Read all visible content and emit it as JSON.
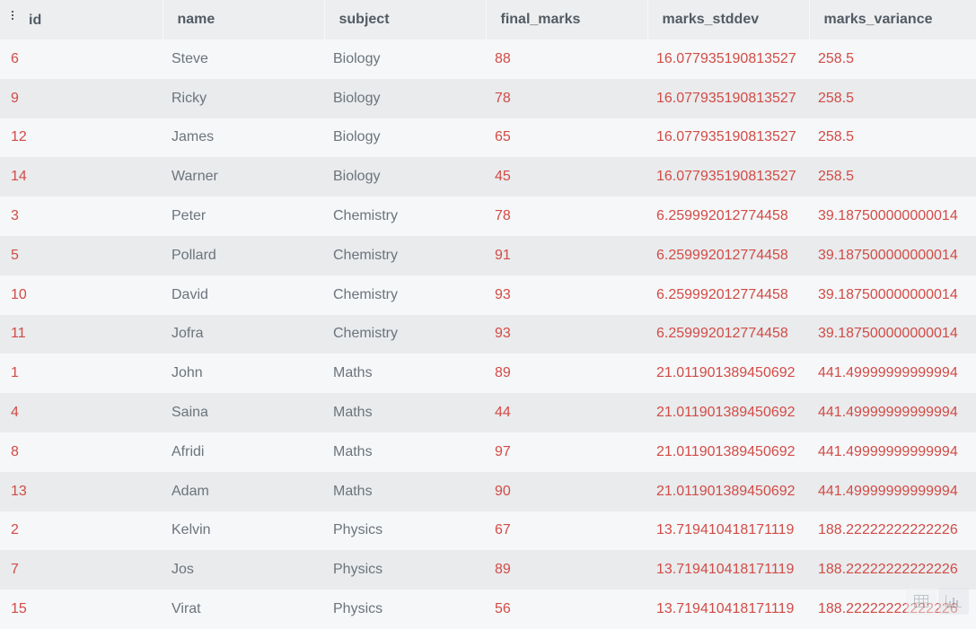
{
  "table": {
    "columns": [
      "id",
      "name",
      "subject",
      "final_marks",
      "marks_stddev",
      "marks_variance"
    ],
    "rows": [
      [
        "6",
        "Steve",
        "Biology",
        "88",
        "16.077935190813527",
        "258.5"
      ],
      [
        "9",
        "Ricky",
        "Biology",
        "78",
        "16.077935190813527",
        "258.5"
      ],
      [
        "12",
        "James",
        "Biology",
        "65",
        "16.077935190813527",
        "258.5"
      ],
      [
        "14",
        "Warner",
        "Biology",
        "45",
        "16.077935190813527",
        "258.5"
      ],
      [
        "3",
        "Peter",
        "Chemistry",
        "78",
        "6.259992012774458",
        "39.187500000000014"
      ],
      [
        "5",
        "Pollard",
        "Chemistry",
        "91",
        "6.259992012774458",
        "39.187500000000014"
      ],
      [
        "10",
        "David",
        "Chemistry",
        "93",
        "6.259992012774458",
        "39.187500000000014"
      ],
      [
        "11",
        "Jofra",
        "Chemistry",
        "93",
        "6.259992012774458",
        "39.187500000000014"
      ],
      [
        "1",
        "John",
        "Maths",
        "89",
        "21.011901389450692",
        "441.49999999999994"
      ],
      [
        "4",
        "Saina",
        "Maths",
        "44",
        "21.011901389450692",
        "441.49999999999994"
      ],
      [
        "8",
        "Afridi",
        "Maths",
        "97",
        "21.011901389450692",
        "441.49999999999994"
      ],
      [
        "13",
        "Adam",
        "Maths",
        "90",
        "21.011901389450692",
        "441.49999999999994"
      ],
      [
        "2",
        "Kelvin",
        "Physics",
        "67",
        "13.719410418171119",
        "188.22222222222226"
      ],
      [
        "7",
        "Jos",
        "Physics",
        "89",
        "13.719410418171119",
        "188.22222222222226"
      ],
      [
        "15",
        "Virat",
        "Physics",
        "56",
        "13.719410418171119",
        "188.22222222222226"
      ]
    ]
  },
  "icons": {
    "column_drag": "drag-handle-icon",
    "table_view": "table-view-icon",
    "chart_view": "chart-view-icon"
  },
  "colors": {
    "header_bg": "#eceef0",
    "header_text": "#525b63",
    "numeric_text": "#d24b45",
    "string_text": "#6b747c",
    "row_odd": "#f6f7f9",
    "row_even": "#e9ebed"
  }
}
